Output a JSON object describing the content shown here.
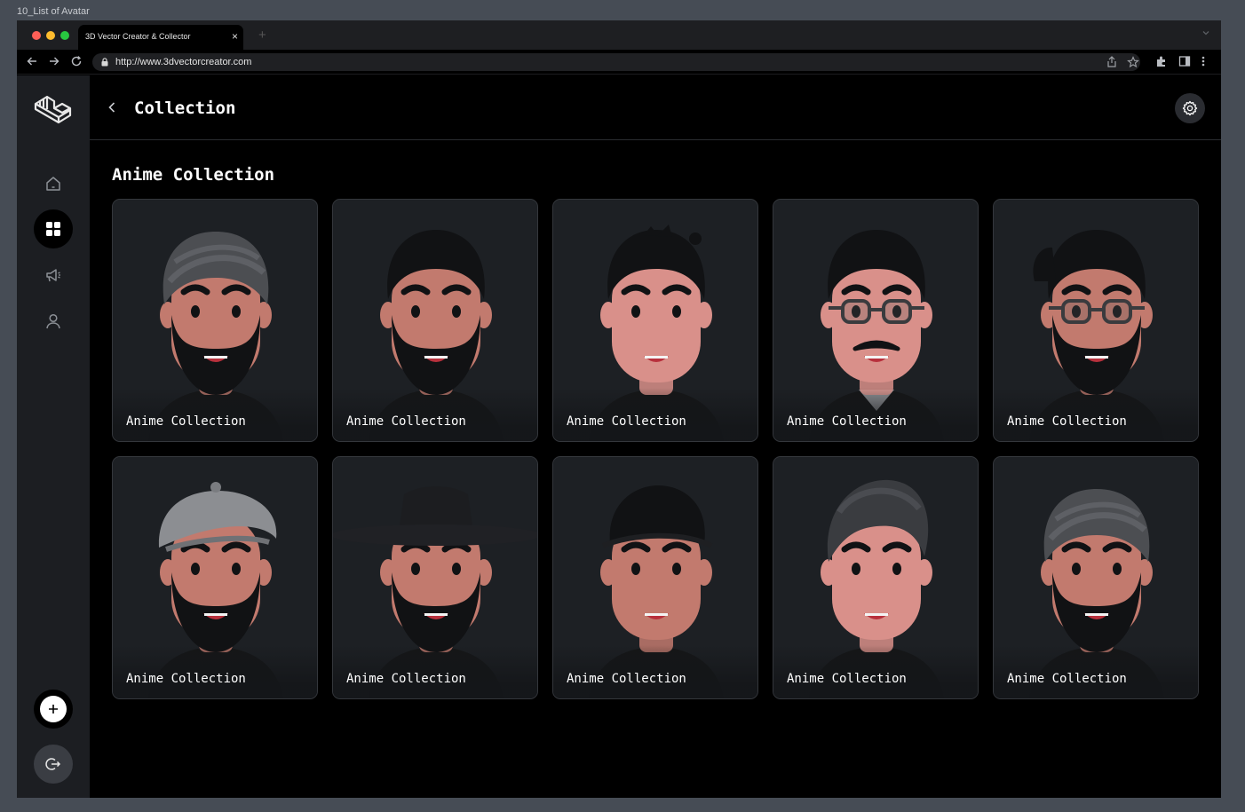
{
  "frame": {
    "label": "10_List of Avatar"
  },
  "browser": {
    "tab_title": "3D Vector Creator & Collector",
    "tab_close": "×",
    "new_tab": "+",
    "url": "http://www.3dvectorcreator.com"
  },
  "sidebar": {
    "items": [
      {
        "name": "home",
        "icon": "home-icon"
      },
      {
        "name": "collection",
        "icon": "grid-icon",
        "active": true
      },
      {
        "name": "announcements",
        "icon": "megaphone-icon"
      },
      {
        "name": "profile",
        "icon": "user-icon"
      }
    ],
    "add_icon": "plus-icon",
    "logout_icon": "logout-icon"
  },
  "header": {
    "title": "Collection"
  },
  "section": {
    "title": "Anime Collection"
  },
  "cards": [
    {
      "label": "Anime Collection",
      "style": "turban-beard"
    },
    {
      "label": "Anime Collection",
      "style": "hair-beard"
    },
    {
      "label": "Anime Collection",
      "style": "spiky-clean"
    },
    {
      "label": "Anime Collection",
      "style": "glasses-mustache"
    },
    {
      "label": "Anime Collection",
      "style": "glasses-beard"
    },
    {
      "label": "Anime Collection",
      "style": "beret-beard"
    },
    {
      "label": "Anime Collection",
      "style": "hat-beard"
    },
    {
      "label": "Anime Collection",
      "style": "cap-clean"
    },
    {
      "label": "Anime Collection",
      "style": "quiff-clean"
    },
    {
      "label": "Anime Collection",
      "style": "turban-beard"
    }
  ],
  "colors": {
    "accent_active": "#000000",
    "sidebar_bg": "#1c1e22",
    "card_bg": "#1d2024",
    "skin": "#c27a6e"
  }
}
